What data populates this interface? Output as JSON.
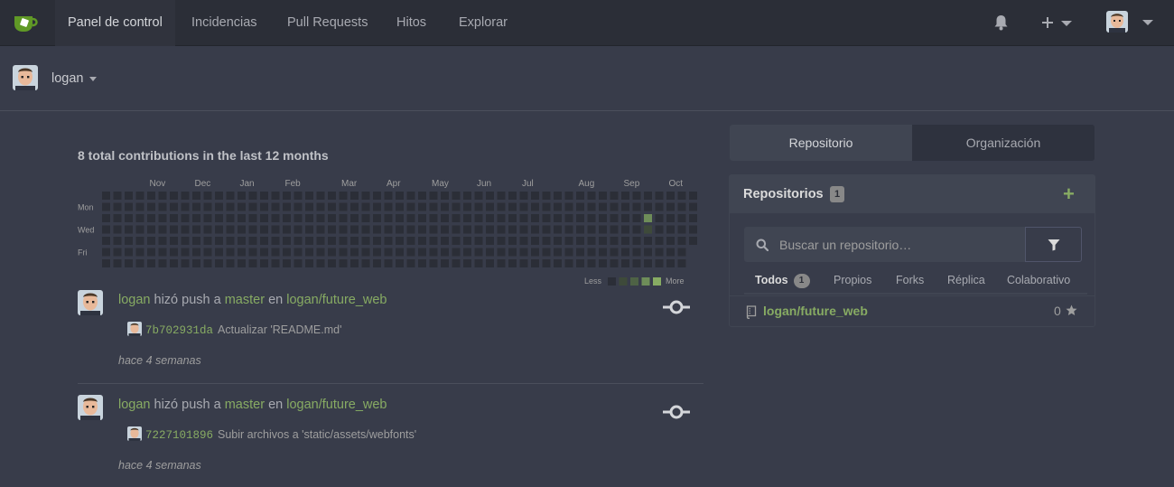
{
  "nav": {
    "items": [
      {
        "label": "Panel de control",
        "active": true
      },
      {
        "label": "Incidencias",
        "active": false
      },
      {
        "label": "Pull Requests",
        "active": false
      },
      {
        "label": "Hitos",
        "active": false
      },
      {
        "label": "Explorar",
        "active": false
      }
    ],
    "icons": [
      "logo-icon",
      "bell-icon",
      "plus-icon",
      "avatar",
      "chevron-down-icon"
    ]
  },
  "context": {
    "username": "logan"
  },
  "heatmap": {
    "title": "8 total contributions in the last 12 months",
    "months": [
      "Nov",
      "Dec",
      "Jan",
      "Feb",
      "Mar",
      "Apr",
      "May",
      "Jun",
      "Jul",
      "Aug",
      "Sep",
      "Oct"
    ],
    "days": [
      "Mon",
      "Wed",
      "Fri"
    ],
    "legend_less": "Less",
    "legend_more": "More",
    "active_cells": [
      {
        "week": 48,
        "day": 2,
        "level": 3
      },
      {
        "week": 48,
        "day": 3,
        "level": 1
      }
    ],
    "colors": {
      "empty": "#2b2e37",
      "levels": [
        "#2b2e37",
        "#3e4a3a",
        "#4e6245",
        "#6e8d59",
        "#87ab63"
      ]
    }
  },
  "feed": [
    {
      "user": "logan",
      "action": "hizó push a",
      "branch": "master",
      "preposition": "en",
      "repo": "logan/future_web",
      "sha": "7b702931da",
      "message": "Actualizar 'README.md'",
      "time": "hace 4 semanas"
    },
    {
      "user": "logan",
      "action": "hizó push a",
      "branch": "master",
      "preposition": "en",
      "repo": "logan/future_web",
      "sha": "7227101896",
      "message": "Subir archivos a 'static/assets/webfonts'",
      "time": "hace 4 semanas"
    }
  ],
  "panel": {
    "tabs": [
      {
        "label": "Repositorio",
        "active": true
      },
      {
        "label": "Organización",
        "active": false
      }
    ],
    "repo_header": {
      "title": "Repositorios",
      "count": "1",
      "add": "+"
    },
    "search": {
      "placeholder": "Buscar un repositorio…"
    },
    "subtabs": [
      {
        "label": "Todos",
        "count": "1",
        "active": true
      },
      {
        "label": "Propios",
        "active": false
      },
      {
        "label": "Forks",
        "active": false
      },
      {
        "label": "Réplica",
        "active": false
      },
      {
        "label": "Colaborativo",
        "active": false
      }
    ],
    "repos": [
      {
        "name": "logan/future_web",
        "stars": "0"
      }
    ]
  },
  "colors": {
    "accent": "#87ab63",
    "nav_bg": "#2b2e37",
    "page_bg": "#383c4a"
  }
}
